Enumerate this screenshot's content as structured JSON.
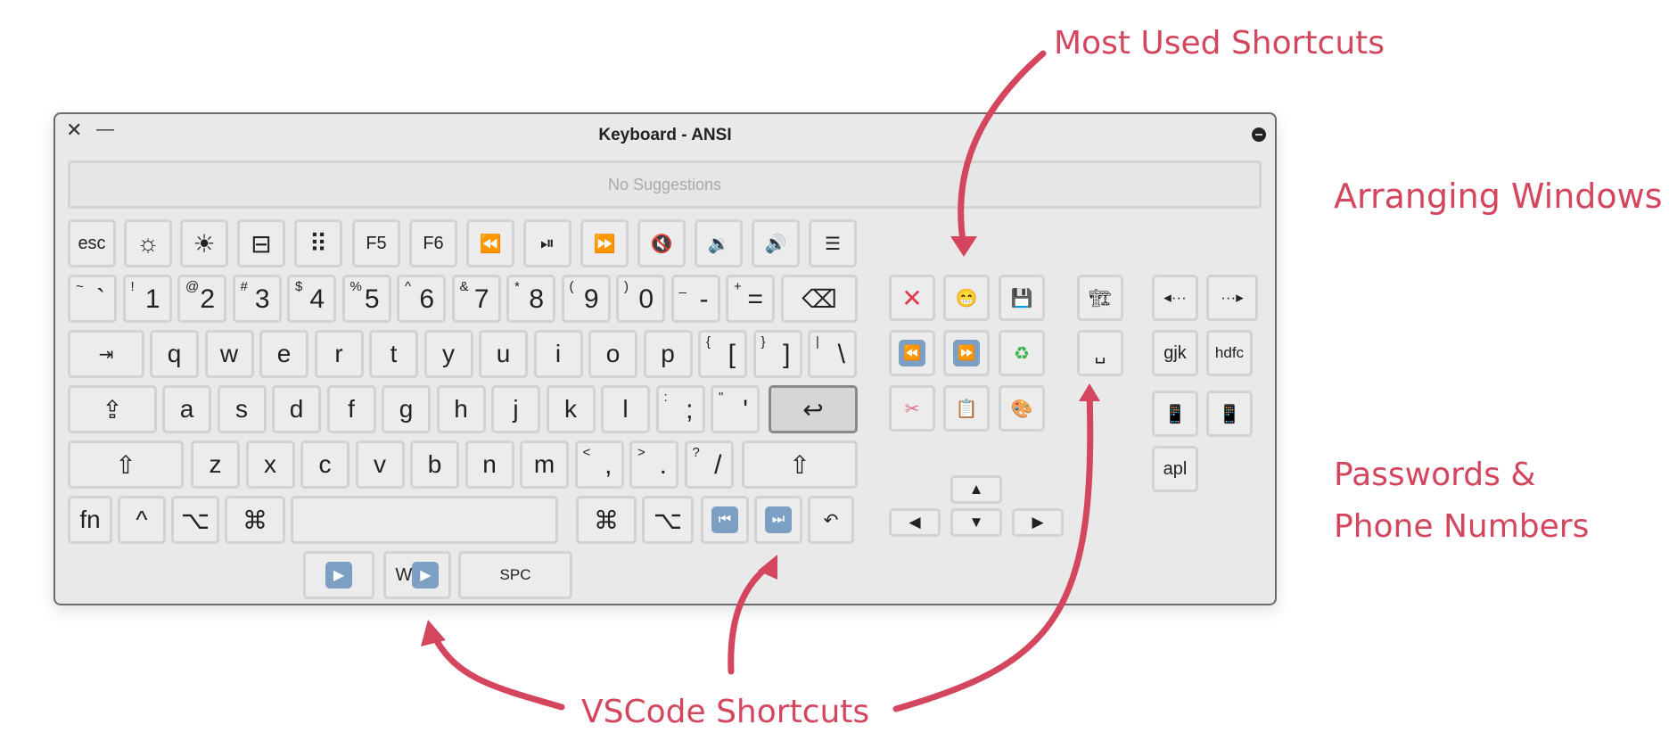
{
  "annotations": {
    "most_used": "Most Used Shortcuts",
    "arranging": "Arranging Windows",
    "passwords_line1": "Passwords &",
    "passwords_line2": "Phone Numbers",
    "vscode": "VSCode Shortcuts",
    "accent_color": "#d3465e"
  },
  "window": {
    "title": "Keyboard - ANSI",
    "close_glyph": "✕",
    "minimize_glyph": "—",
    "suggestions_text": "No Suggestions"
  },
  "fn_row": {
    "esc": "esc",
    "f5": "F5",
    "f6": "F6",
    "brightness_down": "☼",
    "brightness_up": "☀",
    "mission_control": "⊟",
    "launchpad": "⠿",
    "rewind": "⏪",
    "play_pause": "⏯",
    "fast_forward": "⏩",
    "mute": "🔇",
    "vol_down": "🔉",
    "vol_up": "🔊",
    "list": "☰"
  },
  "num_row": [
    {
      "shift": "~",
      "main": "`"
    },
    {
      "shift": "!",
      "main": "1"
    },
    {
      "shift": "@",
      "main": "2"
    },
    {
      "shift": "#",
      "main": "3"
    },
    {
      "shift": "$",
      "main": "4"
    },
    {
      "shift": "%",
      "main": "5"
    },
    {
      "shift": "^",
      "main": "6"
    },
    {
      "shift": "&",
      "main": "7"
    },
    {
      "shift": "*",
      "main": "8"
    },
    {
      "shift": "(",
      "main": "9"
    },
    {
      "shift": ")",
      "main": "0"
    },
    {
      "shift": "_",
      "main": "-"
    },
    {
      "shift": "+",
      "main": "="
    }
  ],
  "delete": "⌫",
  "tab": "⇥",
  "q_row": [
    "q",
    "w",
    "e",
    "r",
    "t",
    "y",
    "u",
    "i",
    "o",
    "p"
  ],
  "q_row_sym": [
    {
      "shift": "{",
      "main": "["
    },
    {
      "shift": "}",
      "main": "]"
    },
    {
      "shift": "|",
      "main": "\\"
    }
  ],
  "caps": "⇪",
  "a_row": [
    "a",
    "s",
    "d",
    "f",
    "g",
    "h",
    "j",
    "k",
    "l"
  ],
  "a_row_sym": [
    {
      "shift": ":",
      "main": ";"
    },
    {
      "shift": "\"",
      "main": "'"
    }
  ],
  "return": "↩",
  "shift": "⇧",
  "z_row": [
    "z",
    "x",
    "c",
    "v",
    "b",
    "n",
    "m"
  ],
  "z_row_sym": [
    {
      "shift": "<",
      "main": ","
    },
    {
      "shift": ">",
      "main": "."
    },
    {
      "shift": "?",
      "main": "/"
    }
  ],
  "bottom_row": {
    "fn": "fn",
    "ctrl": "^",
    "opt": "⌥",
    "cmd": "⌘",
    "prev": "⏮",
    "next": "⏭",
    "undo": "↶"
  },
  "extra_row": {
    "play": "▶",
    "w_play_prefix": "W",
    "w_play": "▶",
    "spc": "SPC"
  },
  "shortcuts": {
    "close": "✕",
    "smile": "😁",
    "save": "💾",
    "back": "⏪",
    "fwd": "⏩",
    "recycle": "♻",
    "cut": "✂",
    "clipboard": "📋",
    "palette": "🎨"
  },
  "arrows": {
    "up": "▲",
    "down": "▼",
    "left": "◀",
    "right": "▶"
  },
  "window_keys": {
    "crane": "🏗",
    "space": "␣"
  },
  "right_keys": {
    "left_dots": "◂···",
    "right_dots": "···▸",
    "gjk": "gjk",
    "hdfc": "hdfc",
    "phone1": "📱",
    "phone2": "📱",
    "apl": "apl"
  }
}
